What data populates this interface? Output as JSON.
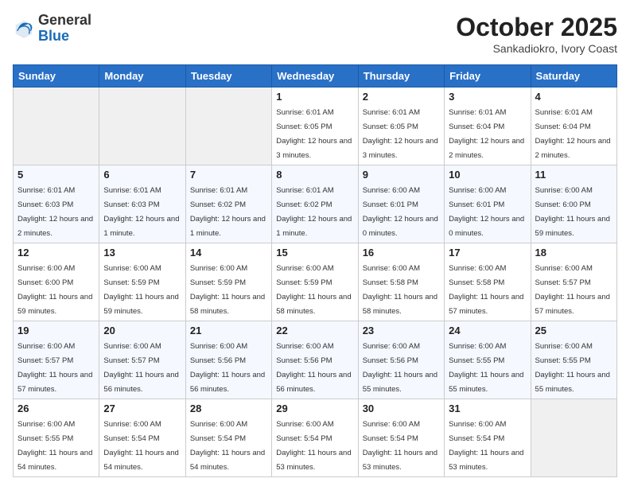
{
  "header": {
    "logo_line1": "General",
    "logo_line2": "Blue",
    "month": "October 2025",
    "location": "Sankadiokro, Ivory Coast"
  },
  "weekdays": [
    "Sunday",
    "Monday",
    "Tuesday",
    "Wednesday",
    "Thursday",
    "Friday",
    "Saturday"
  ],
  "weeks": [
    [
      {
        "day": "",
        "empty": true
      },
      {
        "day": "",
        "empty": true
      },
      {
        "day": "",
        "empty": true
      },
      {
        "day": "1",
        "sunrise": "6:01 AM",
        "sunset": "6:05 PM",
        "daylight": "12 hours and 3 minutes."
      },
      {
        "day": "2",
        "sunrise": "6:01 AM",
        "sunset": "6:05 PM",
        "daylight": "12 hours and 3 minutes."
      },
      {
        "day": "3",
        "sunrise": "6:01 AM",
        "sunset": "6:04 PM",
        "daylight": "12 hours and 2 minutes."
      },
      {
        "day": "4",
        "sunrise": "6:01 AM",
        "sunset": "6:04 PM",
        "daylight": "12 hours and 2 minutes."
      }
    ],
    [
      {
        "day": "5",
        "sunrise": "6:01 AM",
        "sunset": "6:03 PM",
        "daylight": "12 hours and 2 minutes."
      },
      {
        "day": "6",
        "sunrise": "6:01 AM",
        "sunset": "6:03 PM",
        "daylight": "12 hours and 1 minute."
      },
      {
        "day": "7",
        "sunrise": "6:01 AM",
        "sunset": "6:02 PM",
        "daylight": "12 hours and 1 minute."
      },
      {
        "day": "8",
        "sunrise": "6:01 AM",
        "sunset": "6:02 PM",
        "daylight": "12 hours and 1 minute."
      },
      {
        "day": "9",
        "sunrise": "6:00 AM",
        "sunset": "6:01 PM",
        "daylight": "12 hours and 0 minutes."
      },
      {
        "day": "10",
        "sunrise": "6:00 AM",
        "sunset": "6:01 PM",
        "daylight": "12 hours and 0 minutes."
      },
      {
        "day": "11",
        "sunrise": "6:00 AM",
        "sunset": "6:00 PM",
        "daylight": "11 hours and 59 minutes."
      }
    ],
    [
      {
        "day": "12",
        "sunrise": "6:00 AM",
        "sunset": "6:00 PM",
        "daylight": "11 hours and 59 minutes."
      },
      {
        "day": "13",
        "sunrise": "6:00 AM",
        "sunset": "5:59 PM",
        "daylight": "11 hours and 59 minutes."
      },
      {
        "day": "14",
        "sunrise": "6:00 AM",
        "sunset": "5:59 PM",
        "daylight": "11 hours and 58 minutes."
      },
      {
        "day": "15",
        "sunrise": "6:00 AM",
        "sunset": "5:59 PM",
        "daylight": "11 hours and 58 minutes."
      },
      {
        "day": "16",
        "sunrise": "6:00 AM",
        "sunset": "5:58 PM",
        "daylight": "11 hours and 58 minutes."
      },
      {
        "day": "17",
        "sunrise": "6:00 AM",
        "sunset": "5:58 PM",
        "daylight": "11 hours and 57 minutes."
      },
      {
        "day": "18",
        "sunrise": "6:00 AM",
        "sunset": "5:57 PM",
        "daylight": "11 hours and 57 minutes."
      }
    ],
    [
      {
        "day": "19",
        "sunrise": "6:00 AM",
        "sunset": "5:57 PM",
        "daylight": "11 hours and 57 minutes."
      },
      {
        "day": "20",
        "sunrise": "6:00 AM",
        "sunset": "5:57 PM",
        "daylight": "11 hours and 56 minutes."
      },
      {
        "day": "21",
        "sunrise": "6:00 AM",
        "sunset": "5:56 PM",
        "daylight": "11 hours and 56 minutes."
      },
      {
        "day": "22",
        "sunrise": "6:00 AM",
        "sunset": "5:56 PM",
        "daylight": "11 hours and 56 minutes."
      },
      {
        "day": "23",
        "sunrise": "6:00 AM",
        "sunset": "5:56 PM",
        "daylight": "11 hours and 55 minutes."
      },
      {
        "day": "24",
        "sunrise": "6:00 AM",
        "sunset": "5:55 PM",
        "daylight": "11 hours and 55 minutes."
      },
      {
        "day": "25",
        "sunrise": "6:00 AM",
        "sunset": "5:55 PM",
        "daylight": "11 hours and 55 minutes."
      }
    ],
    [
      {
        "day": "26",
        "sunrise": "6:00 AM",
        "sunset": "5:55 PM",
        "daylight": "11 hours and 54 minutes."
      },
      {
        "day": "27",
        "sunrise": "6:00 AM",
        "sunset": "5:54 PM",
        "daylight": "11 hours and 54 minutes."
      },
      {
        "day": "28",
        "sunrise": "6:00 AM",
        "sunset": "5:54 PM",
        "daylight": "11 hours and 54 minutes."
      },
      {
        "day": "29",
        "sunrise": "6:00 AM",
        "sunset": "5:54 PM",
        "daylight": "11 hours and 53 minutes."
      },
      {
        "day": "30",
        "sunrise": "6:00 AM",
        "sunset": "5:54 PM",
        "daylight": "11 hours and 53 minutes."
      },
      {
        "day": "31",
        "sunrise": "6:00 AM",
        "sunset": "5:54 PM",
        "daylight": "11 hours and 53 minutes."
      },
      {
        "day": "",
        "empty": true
      }
    ]
  ]
}
